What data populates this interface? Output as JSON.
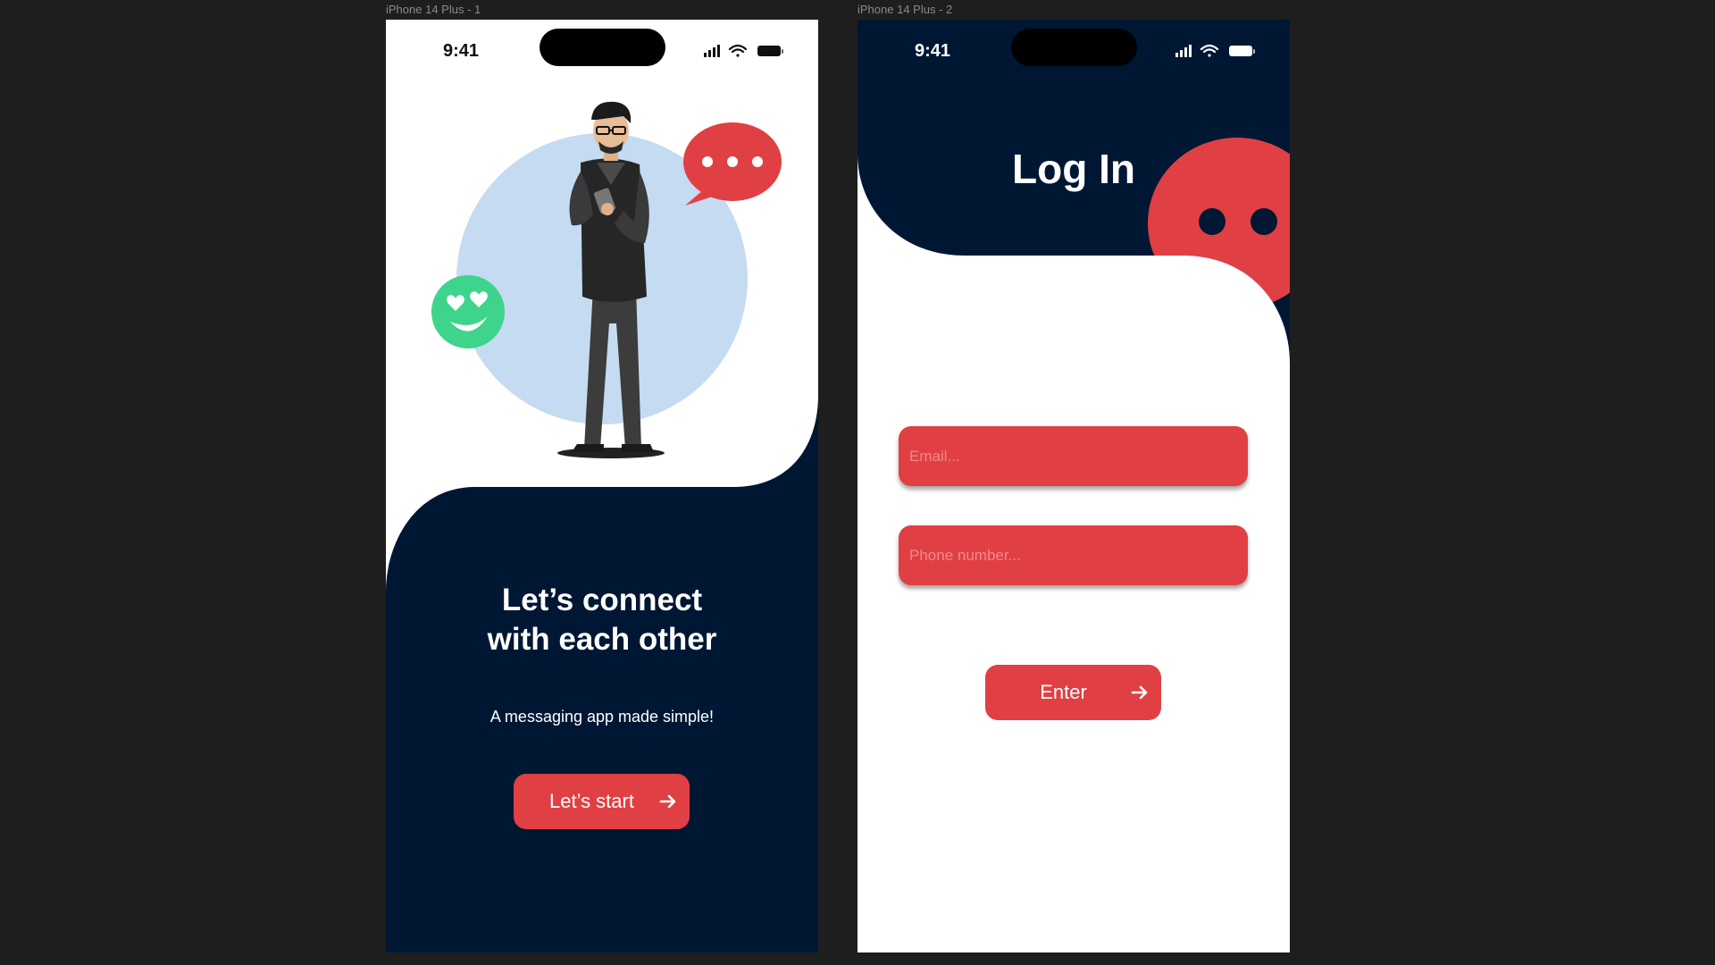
{
  "frames": [
    {
      "label": "iPhone 14 Plus - 1",
      "status": {
        "time": "9:41"
      },
      "headline_line1": "Let’s connect",
      "headline_line2": "with each other",
      "subtitle": "A messaging app made simple!",
      "button_label": "Let’s start"
    },
    {
      "label": "iPhone 14 Plus - 2",
      "status": {
        "time": "9:41"
      },
      "title": "Log In",
      "email_placeholder": "Email...",
      "phone_placeholder": "Phone number...",
      "button_label": "Enter"
    }
  ],
  "colors": {
    "navy": "#001733",
    "accent_red": "#e04043",
    "light_blue_circle": "#c5dbf1",
    "emoji_green": "#3fd48c",
    "canvas_bg": "#1e1e1e"
  },
  "icons": [
    "signal-icon",
    "wifi-icon",
    "battery-icon",
    "arrow-right-icon",
    "chat-bubble-icon",
    "heart-eyes-emoji-icon"
  ]
}
